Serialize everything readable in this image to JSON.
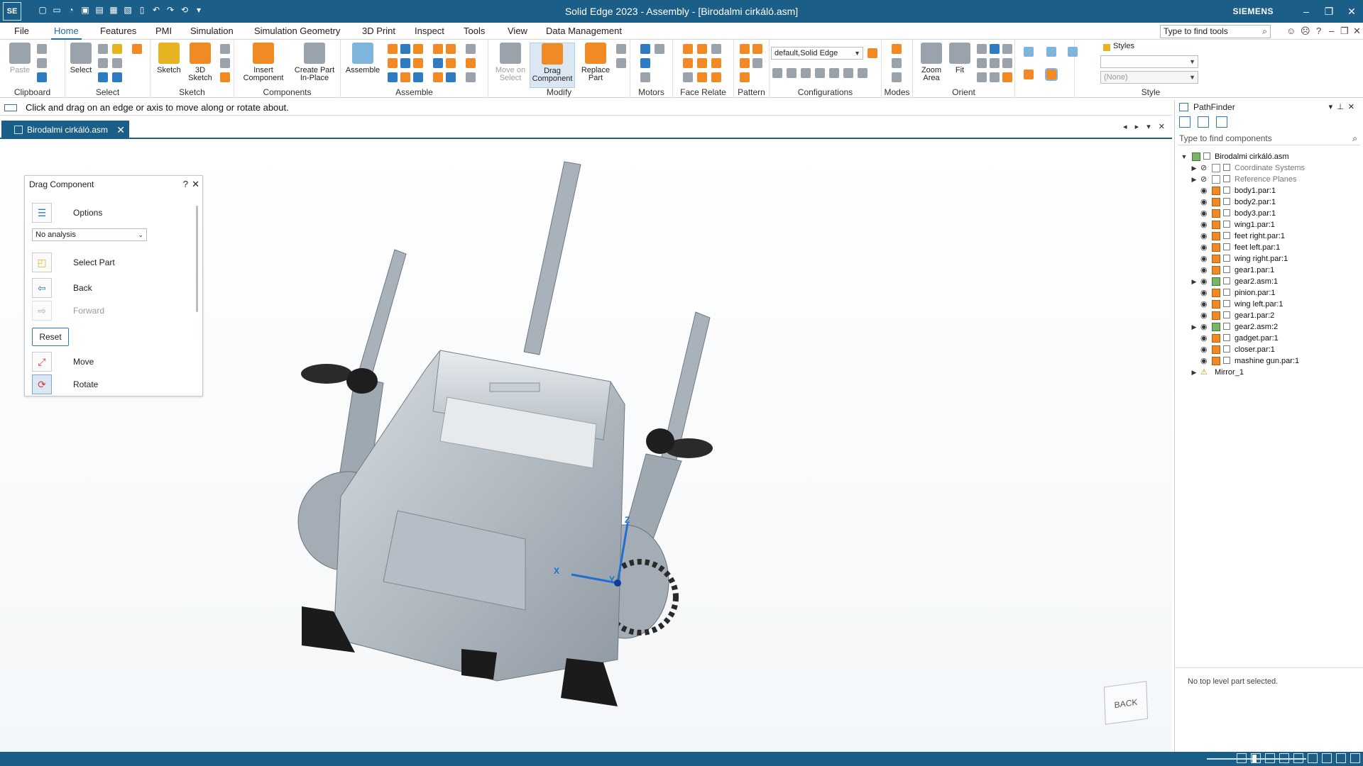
{
  "app": {
    "logo": "SE",
    "title": "Solid Edge 2023 - Assembly - [Birodalmi cirkáló.asm]",
    "brand": "SIEMENS",
    "window_controls": [
      "–",
      "❐",
      "✕"
    ]
  },
  "menu": {
    "tabs": [
      "File",
      "Home",
      "Features",
      "PMI",
      "Simulation",
      "Simulation Geometry",
      "3D Print",
      "Inspect",
      "Tools",
      "View",
      "Data Management"
    ],
    "active_tab": "Home",
    "search_placeholder": "Type to find tools"
  },
  "ribbon": {
    "groups": {
      "clipboard": "Clipboard",
      "select": "Select",
      "sketch": "Sketch",
      "components": "Components",
      "assemble": "Assemble",
      "modify": "Modify",
      "motors": "Motors",
      "face_relate": "Face Relate",
      "pattern": "Pattern",
      "configurations": "Configurations",
      "modes": "Modes",
      "orient": "Orient",
      "style": "Style"
    },
    "buttons": {
      "paste": "Paste",
      "select": "Select",
      "sketch": "Sketch",
      "sketch3d_1": "3D",
      "sketch3d_2": "Sketch",
      "insert_1": "Insert",
      "insert_2": "Component",
      "create_1": "Create Part",
      "create_2": "In-Place",
      "assemble": "Assemble",
      "move_1": "Move on",
      "move_2": "Select",
      "drag_1": "Drag",
      "drag_2": "Component",
      "replace_1": "Replace",
      "replace_2": "Part",
      "zoom_1": "Zoom",
      "zoom_2": "Area",
      "fit": "Fit",
      "styles": "Styles"
    },
    "config_value": "default,Solid Edge",
    "style_value": "",
    "style_none": "(None)"
  },
  "prompt": "Click and drag on an edge or axis to move along or rotate about.",
  "document_tab": "Birodalmi cirkáló.asm",
  "drag_panel": {
    "title": "Drag Component",
    "help": "?",
    "close": "✕",
    "options": "Options",
    "analysis": "No analysis",
    "select_part": "Select Part",
    "back": "Back",
    "forward": "Forward",
    "reset": "Reset",
    "move": "Move",
    "rotate": "Rotate"
  },
  "pathfinder": {
    "title": "PathFinder",
    "search_placeholder": "Type to find components",
    "root": "Birodalmi cirkáló.asm",
    "items": [
      {
        "name": "Coordinate Systems",
        "kind": "ref"
      },
      {
        "name": "Reference Planes",
        "kind": "ref"
      },
      {
        "name": "body1.par:1",
        "kind": "part"
      },
      {
        "name": "body2.par:1",
        "kind": "part"
      },
      {
        "name": "body3.par:1",
        "kind": "part"
      },
      {
        "name": "wing1.par:1",
        "kind": "part"
      },
      {
        "name": "feet right.par:1",
        "kind": "part"
      },
      {
        "name": "feet left.par:1",
        "kind": "part"
      },
      {
        "name": "wing right.par:1",
        "kind": "part"
      },
      {
        "name": "gear1.par:1",
        "kind": "part"
      },
      {
        "name": "gear2.asm:1",
        "kind": "asm"
      },
      {
        "name": "pinion.par:1",
        "kind": "part"
      },
      {
        "name": "wing left.par:1",
        "kind": "part"
      },
      {
        "name": "gear1.par:2",
        "kind": "part"
      },
      {
        "name": "gear2.asm:2",
        "kind": "asm"
      },
      {
        "name": "gadget.par:1",
        "kind": "part"
      },
      {
        "name": "closer.par:1",
        "kind": "part"
      },
      {
        "name": "mashine gun.par:1",
        "kind": "part"
      },
      {
        "name": "Mirror_1",
        "kind": "mirror"
      }
    ],
    "status": "No top level part selected."
  },
  "viewport": {
    "triad": {
      "x": "X",
      "y": "Y",
      "z": "Z"
    },
    "view_cube": "BACK"
  },
  "colors": {
    "titlebar": "#1b5f88",
    "accent": "#1b6fb0",
    "part": "#f08a24",
    "model": "#aeb7bf"
  }
}
